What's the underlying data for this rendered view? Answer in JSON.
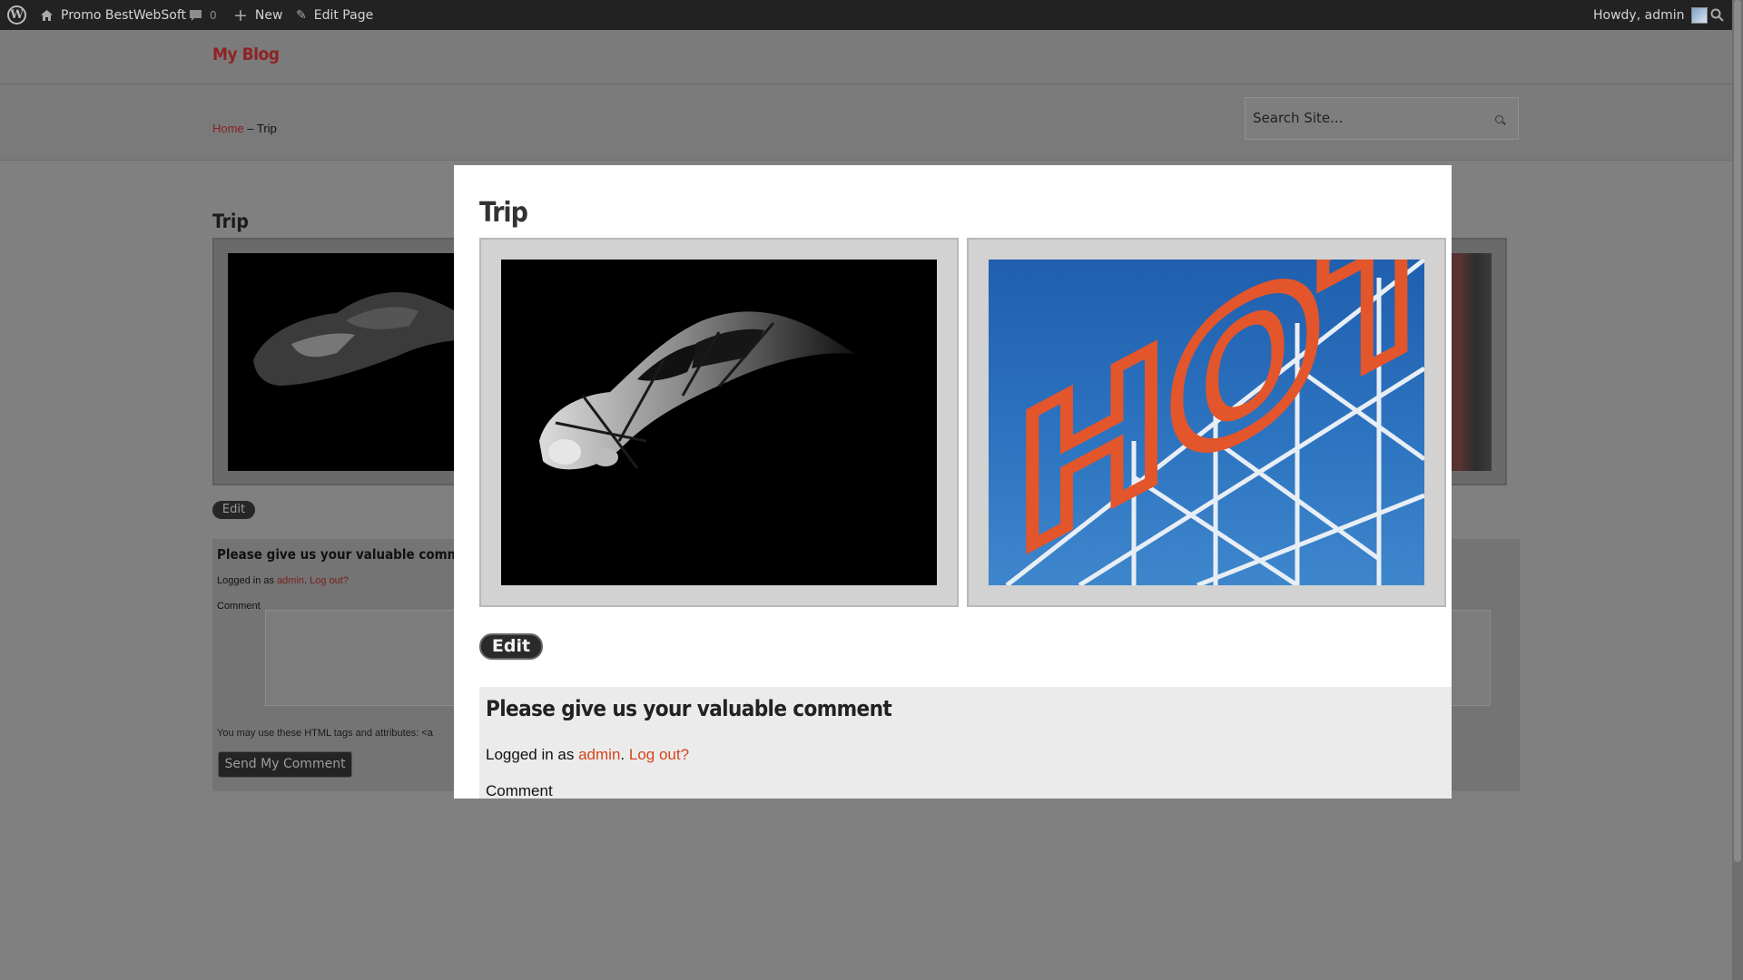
{
  "admin_bar": {
    "wp_logo_icon": "wordpress-logo-icon",
    "site_name": "Promo BestWebSoft",
    "comments_count": "0",
    "new_label": "New",
    "edit_page_label": "Edit Page",
    "howdy": "Howdy, admin"
  },
  "site": {
    "title": "My Blog"
  },
  "breadcrumb": {
    "home": "Home",
    "separator": " – ",
    "current": "Trip"
  },
  "search": {
    "placeholder": "Search Site..."
  },
  "page": {
    "title": "Trip",
    "edit_label": "Edit",
    "comment": {
      "heading": "Please give us your valuable comment",
      "logged_prefix": "Logged in as ",
      "user": "admin",
      "separator": ". ",
      "logout": "Log out?",
      "comment_label": "Comment",
      "tags_hint": "You may use these HTML tags and attributes: <a",
      "send_label": "Send My Comment"
    }
  },
  "modal": {
    "title": "Trip",
    "images": [
      "car-photo",
      "hotel-sign-photo"
    ],
    "hotel_sign_text": "HOTE",
    "edit_label": "Edit",
    "comment": {
      "heading": "Please give us your valuable comment",
      "logged_prefix": "Logged in as ",
      "user": "admin",
      "separator": ". ",
      "logout": "Log out?",
      "comment_label": "Comment"
    }
  },
  "colors": {
    "accent": "#d4441d",
    "admin_bar": "#222222",
    "overlay": "#808080"
  }
}
